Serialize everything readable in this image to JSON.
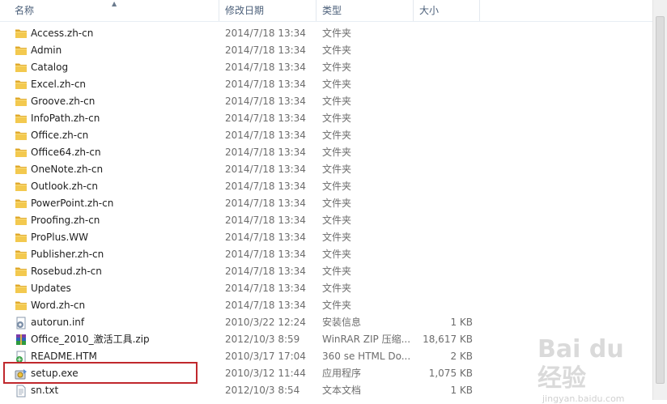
{
  "columns": {
    "name": "名称",
    "date": "修改日期",
    "type": "类型",
    "size": "大小"
  },
  "files": [
    {
      "name": "Access.zh-cn",
      "date": "2014/7/18 13:34",
      "type": "文件夹",
      "size": "",
      "icon": "folder-icon"
    },
    {
      "name": "Admin",
      "date": "2014/7/18 13:34",
      "type": "文件夹",
      "size": "",
      "icon": "folder-icon"
    },
    {
      "name": "Catalog",
      "date": "2014/7/18 13:34",
      "type": "文件夹",
      "size": "",
      "icon": "folder-icon"
    },
    {
      "name": "Excel.zh-cn",
      "date": "2014/7/18 13:34",
      "type": "文件夹",
      "size": "",
      "icon": "folder-icon"
    },
    {
      "name": "Groove.zh-cn",
      "date": "2014/7/18 13:34",
      "type": "文件夹",
      "size": "",
      "icon": "folder-icon"
    },
    {
      "name": "InfoPath.zh-cn",
      "date": "2014/7/18 13:34",
      "type": "文件夹",
      "size": "",
      "icon": "folder-icon"
    },
    {
      "name": "Office.zh-cn",
      "date": "2014/7/18 13:34",
      "type": "文件夹",
      "size": "",
      "icon": "folder-icon"
    },
    {
      "name": "Office64.zh-cn",
      "date": "2014/7/18 13:34",
      "type": "文件夹",
      "size": "",
      "icon": "folder-icon"
    },
    {
      "name": "OneNote.zh-cn",
      "date": "2014/7/18 13:34",
      "type": "文件夹",
      "size": "",
      "icon": "folder-icon"
    },
    {
      "name": "Outlook.zh-cn",
      "date": "2014/7/18 13:34",
      "type": "文件夹",
      "size": "",
      "icon": "folder-icon"
    },
    {
      "name": "PowerPoint.zh-cn",
      "date": "2014/7/18 13:34",
      "type": "文件夹",
      "size": "",
      "icon": "folder-icon"
    },
    {
      "name": "Proofing.zh-cn",
      "date": "2014/7/18 13:34",
      "type": "文件夹",
      "size": "",
      "icon": "folder-icon"
    },
    {
      "name": "ProPlus.WW",
      "date": "2014/7/18 13:34",
      "type": "文件夹",
      "size": "",
      "icon": "folder-icon"
    },
    {
      "name": "Publisher.zh-cn",
      "date": "2014/7/18 13:34",
      "type": "文件夹",
      "size": "",
      "icon": "folder-icon"
    },
    {
      "name": "Rosebud.zh-cn",
      "date": "2014/7/18 13:34",
      "type": "文件夹",
      "size": "",
      "icon": "folder-icon"
    },
    {
      "name": "Updates",
      "date": "2014/7/18 13:34",
      "type": "文件夹",
      "size": "",
      "icon": "folder-icon"
    },
    {
      "name": "Word.zh-cn",
      "date": "2014/7/18 13:34",
      "type": "文件夹",
      "size": "",
      "icon": "folder-icon"
    },
    {
      "name": "autorun.inf",
      "date": "2010/3/22 12:24",
      "type": "安装信息",
      "size": "1 KB",
      "icon": "setup-info-icon"
    },
    {
      "name": "Office_2010_激活工具.zip",
      "date": "2012/10/3 8:59",
      "type": "WinRAR ZIP 压缩...",
      "size": "18,617 KB",
      "icon": "winrar-archive-icon"
    },
    {
      "name": "README.HTM",
      "date": "2010/3/17 17:04",
      "type": "360 se HTML Do...",
      "size": "2 KB",
      "icon": "html-document-icon"
    },
    {
      "name": "setup.exe",
      "date": "2010/3/12 11:44",
      "type": "应用程序",
      "size": "1,075 KB",
      "icon": "setup-exe-icon"
    },
    {
      "name": "sn.txt",
      "date": "2012/10/3 8:54",
      "type": "文本文档",
      "size": "1 KB",
      "icon": "text-file-icon"
    }
  ],
  "watermark": {
    "logo": "Bai du 经验",
    "url": "jingyan.baidu.com"
  },
  "colors": {
    "folder": "#e8b93c",
    "highlight_border": "#c0282d",
    "header_text": "#4c607a"
  }
}
